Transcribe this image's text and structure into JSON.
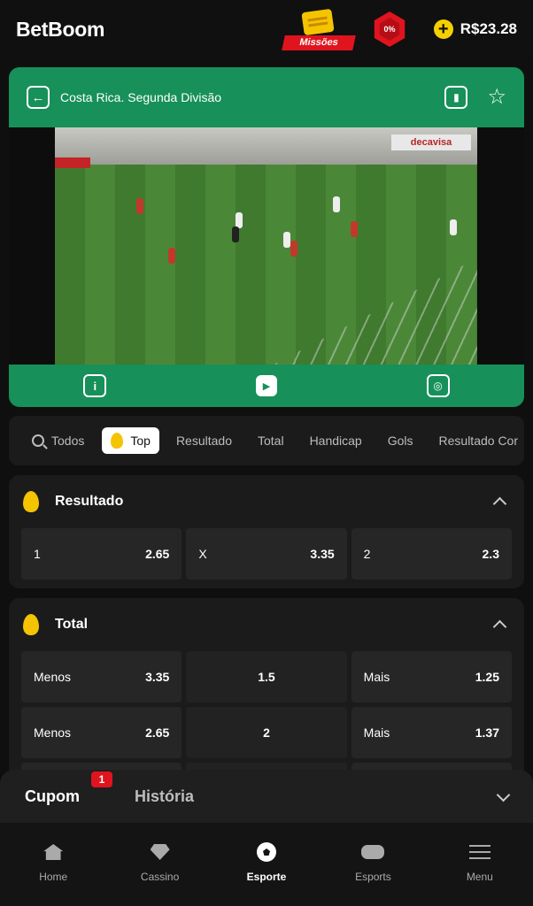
{
  "header": {
    "brand": "BetBoom",
    "missions_label": "Missões",
    "percent_badge": "0%",
    "balance": "R$23.28"
  },
  "match": {
    "title": "Costa Rica. Segunda Divisão",
    "ad_text": "decavisa"
  },
  "filters": [
    "Todos",
    "Top",
    "Resultado",
    "Total",
    "Handicap",
    "Gols",
    "Resultado Cor"
  ],
  "markets": {
    "resultado": {
      "title": "Resultado",
      "outcomes": [
        {
          "label": "1",
          "odd": "2.65"
        },
        {
          "label": "X",
          "odd": "3.35"
        },
        {
          "label": "2",
          "odd": "2.3"
        }
      ]
    },
    "total": {
      "title": "Total",
      "rows": [
        {
          "under_label": "Menos",
          "under_odd": "3.35",
          "line": "1.5",
          "over_label": "Mais",
          "over_odd": "1.25"
        },
        {
          "under_label": "Menos",
          "under_odd": "2.65",
          "line": "2",
          "over_label": "Mais",
          "over_odd": "1.37"
        }
      ]
    }
  },
  "coupon": {
    "tab": "Cupom",
    "count": "1",
    "history": "História"
  },
  "nav": [
    {
      "label": "Home"
    },
    {
      "label": "Cassino"
    },
    {
      "label": "Esporte"
    },
    {
      "label": "Esports"
    },
    {
      "label": "Menu"
    }
  ],
  "colors": {
    "accent_green": "#17905a",
    "badge_red": "#e0141e",
    "flame_yellow": "#f5c400"
  }
}
